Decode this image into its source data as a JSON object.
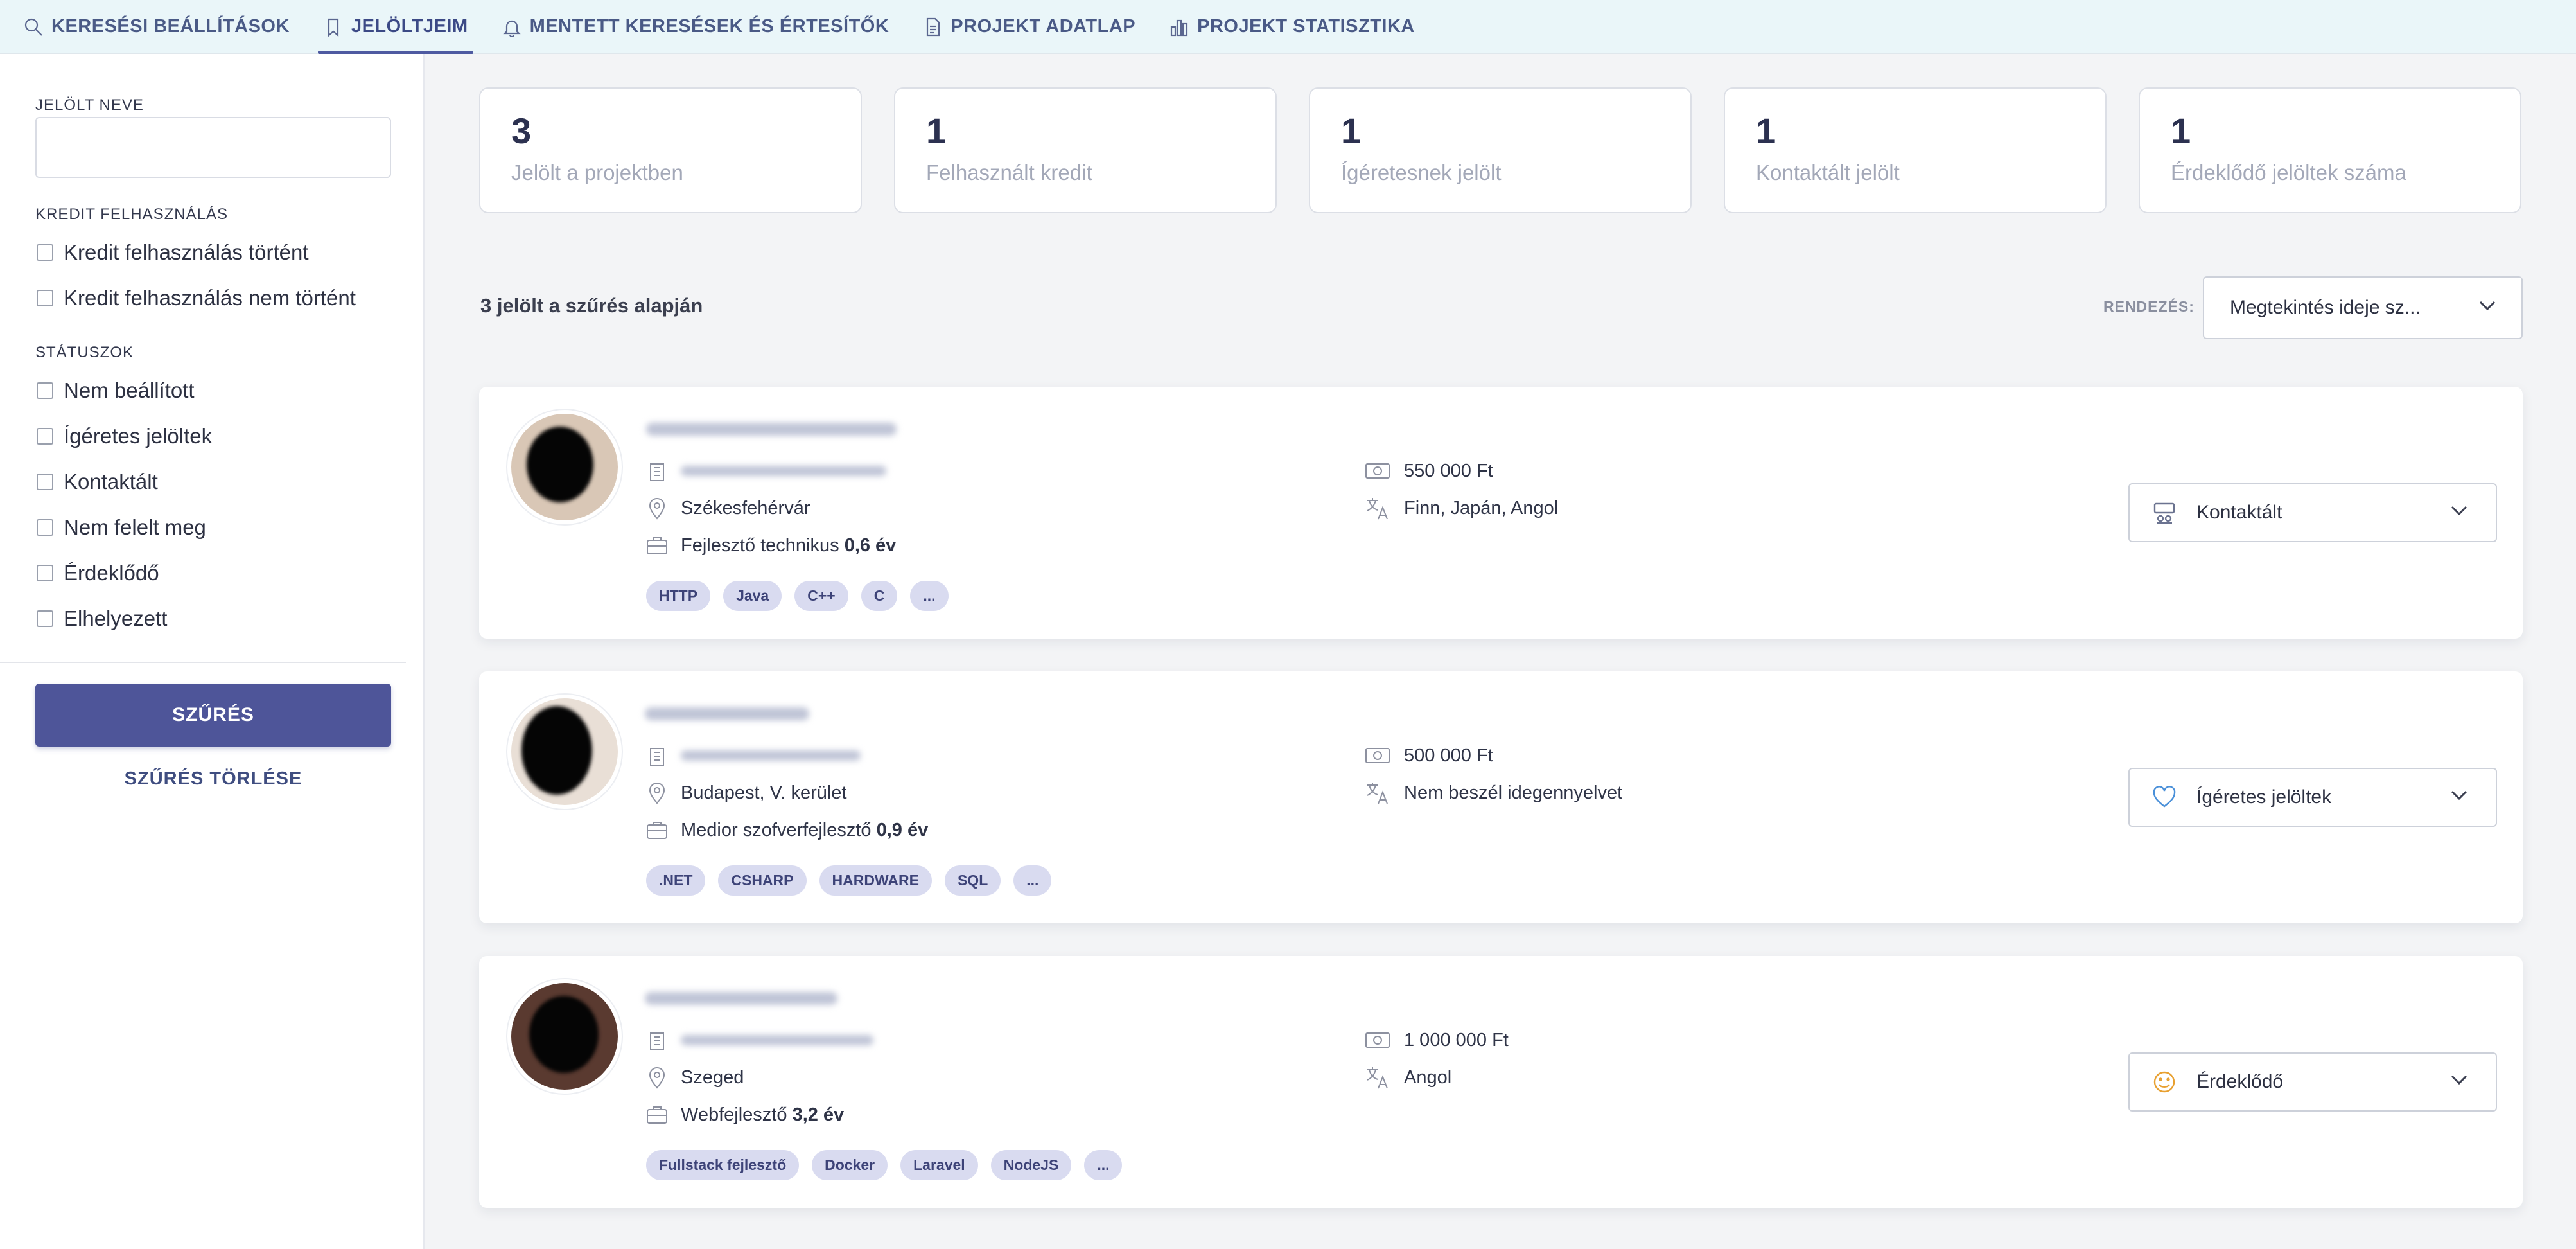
{
  "tabs": [
    {
      "label": "KERESÉSI BEÁLLÍTÁSOK",
      "icon": "search-icon"
    },
    {
      "label": "JELÖLTJEIM",
      "icon": "bookmark-icon",
      "active": true
    },
    {
      "label": "MENTETT KERESÉSEK ÉS ÉRTESÍTŐK",
      "icon": "bell-icon"
    },
    {
      "label": "PROJEKT ADATLAP",
      "icon": "document-icon"
    },
    {
      "label": "PROJEKT STATISZTIKA",
      "icon": "bar-chart-icon"
    }
  ],
  "sidebar": {
    "name_label": "JELÖLT NEVE",
    "name_value": "",
    "credit_label": "KREDIT FELHASZNÁLÁS",
    "credit_options": [
      "Kredit felhasználás történt",
      "Kredit felhasználás nem történt"
    ],
    "status_label": "STÁTUSZOK",
    "status_options": [
      "Nem beállított",
      "Ígéretes jelöltek",
      "Kontaktált",
      "Nem felelt meg",
      "Érdeklődő",
      "Elhelyezett"
    ],
    "filter_button": "SZŰRÉS",
    "clear_link": "SZŰRÉS TÖRLÉSE"
  },
  "stats": [
    {
      "value": "3",
      "label": "Jelölt a projektben"
    },
    {
      "value": "1",
      "label": "Felhasznált kredit"
    },
    {
      "value": "1",
      "label": "Ígéretesnek jelölt"
    },
    {
      "value": "1",
      "label": "Kontaktált jelölt"
    },
    {
      "value": "1",
      "label": "Érdeklődő jelöltek száma"
    }
  ],
  "results": {
    "count_text": "3 jelölt a szűrés alapján",
    "sort_label": "RENDEZÉS:",
    "sort_value": "Megtekintés ideje sz..."
  },
  "candidates": [
    {
      "city": "Székesfehérvár",
      "role": "Fejlesztő technikus",
      "experience": "0,6 év",
      "tags": [
        "HTTP",
        "Java",
        "C++",
        "C",
        "..."
      ],
      "salary": "550 000 Ft",
      "languages": "Finn, Japán, Angol",
      "status": "Kontaktált",
      "status_icon": "contact-card-icon",
      "status_color": "#6b7390"
    },
    {
      "city": "Budapest, V. kerület",
      "role": "Medior szofverfejlesztő",
      "experience": "0,9 év",
      "tags": [
        ".NET",
        "CSHARP",
        "HARDWARE",
        "SQL",
        "..."
      ],
      "salary": "500 000 Ft",
      "languages": "Nem beszél idegennyelvet",
      "status": "Ígéretes jelöltek",
      "status_icon": "heart-icon",
      "status_color": "#4a90d9"
    },
    {
      "city": "Szeged",
      "role": "Webfejlesztő",
      "experience": "3,2 év",
      "tags": [
        "Fullstack fejlesztő",
        "Docker",
        "Laravel",
        "NodeJS",
        "..."
      ],
      "salary": "1 000 000 Ft",
      "languages": "Angol",
      "status": "Érdeklődő",
      "status_icon": "smile-icon",
      "status_color": "#e8a030"
    }
  ]
}
